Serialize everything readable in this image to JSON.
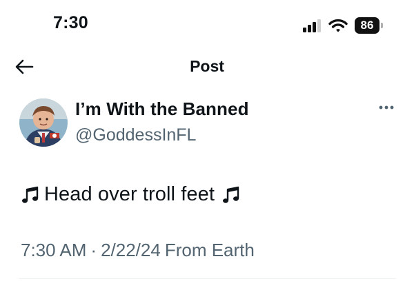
{
  "status_bar": {
    "time": "7:30",
    "battery_level": "86",
    "icons": [
      "signal-icon",
      "wifi-icon",
      "battery-icon"
    ]
  },
  "nav": {
    "title": "Post",
    "back_icon": "arrow-left-icon"
  },
  "post": {
    "author": {
      "display_name": "I’m With the Banned",
      "handle": "@GoddessInFL",
      "avatar_icon": "avatar-image"
    },
    "more_icon": "more-options-icon",
    "text": "Head over troll feet",
    "text_icons": [
      "music-note-icon",
      "music-note-icon"
    ],
    "time": "7:30 AM",
    "separator": "·",
    "date": "2/22/24",
    "source": "From Earth"
  },
  "colors": {
    "text_primary": "#0f1419",
    "text_secondary": "#536471",
    "background": "#ffffff",
    "divider": "#eff3f4"
  }
}
